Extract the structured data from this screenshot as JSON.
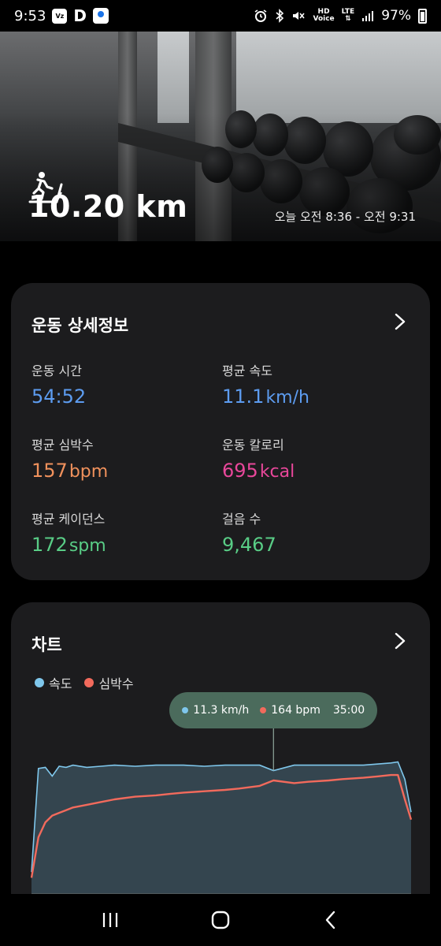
{
  "status_bar": {
    "time": "9:53",
    "app_icons": [
      "verizon-app-icon",
      "d-app-icon",
      "maps-icon"
    ],
    "d_glyph": "D",
    "verizon_text": "Vz",
    "hd_label": "HD",
    "voice_label": "Voice",
    "lte_label": "LTE",
    "battery": "97%"
  },
  "hero": {
    "distance": "10.20 km",
    "time_range": "오늘 오전 8:36 - 오전 9:31",
    "activity_icon": "treadmill-icon"
  },
  "details": {
    "title": "운동 상세정보",
    "metrics": [
      {
        "label": "운동 시간",
        "value": "54:52",
        "unit": "",
        "color": "#5d9cf0"
      },
      {
        "label": "평균 속도",
        "value": "11.1",
        "unit": "km/h",
        "color": "#5d9cf0"
      },
      {
        "label": "평균 심박수",
        "value": "157",
        "unit": "bpm",
        "color": "#f0915c"
      },
      {
        "label": "운동 칼로리",
        "value": "695",
        "unit": "kcal",
        "color": "#e8479a"
      },
      {
        "label": "평균 케이던스",
        "value": "172",
        "unit": "spm",
        "color": "#59cd86"
      },
      {
        "label": "걸음 수",
        "value": "9,467",
        "unit": "",
        "color": "#59cd86"
      }
    ]
  },
  "chart": {
    "title": "차트",
    "legend": {
      "speed": "속도",
      "heart": "심박수"
    },
    "tooltip": {
      "speed": "11.3 km/h",
      "heart": "164 bpm",
      "time": "35:00"
    },
    "colors": {
      "speed": "#7fc7ec",
      "heart": "#f26a5c",
      "fill": "#34454f",
      "tooltip_bg": "#4b6b5c"
    }
  },
  "chart_data": {
    "type": "line",
    "title": "",
    "xlabel": "",
    "ylabel": "",
    "x_unit": "minutes",
    "x": [
      0,
      1,
      2,
      3,
      4,
      5,
      6,
      8,
      10,
      12,
      15,
      18,
      20,
      22,
      25,
      28,
      30,
      33,
      35,
      38,
      40,
      43,
      45,
      48,
      50,
      52,
      53,
      54,
      54.9
    ],
    "series": [
      {
        "name": "속도",
        "unit": "km/h",
        "values": [
          2.0,
          11.5,
          11.6,
          10.8,
          11.7,
          11.6,
          11.8,
          11.6,
          11.7,
          11.8,
          11.7,
          11.8,
          11.8,
          11.8,
          11.7,
          11.8,
          11.8,
          11.8,
          11.3,
          11.8,
          11.8,
          11.8,
          11.8,
          11.8,
          11.9,
          12.0,
          12.1,
          10.5,
          7.5
        ]
      },
      {
        "name": "심박수",
        "unit": "bpm",
        "values": [
          92,
          122,
          133,
          138,
          140,
          142,
          144,
          146,
          148,
          150,
          152,
          153,
          154,
          155,
          156,
          157,
          158,
          160,
          164,
          162,
          163,
          164,
          165,
          166,
          167,
          168,
          168,
          150,
          135
        ]
      }
    ],
    "grid": false,
    "legend_position": "top-left"
  },
  "nav": {
    "recents": "recents-icon",
    "home": "home-icon",
    "back": "back-icon"
  }
}
